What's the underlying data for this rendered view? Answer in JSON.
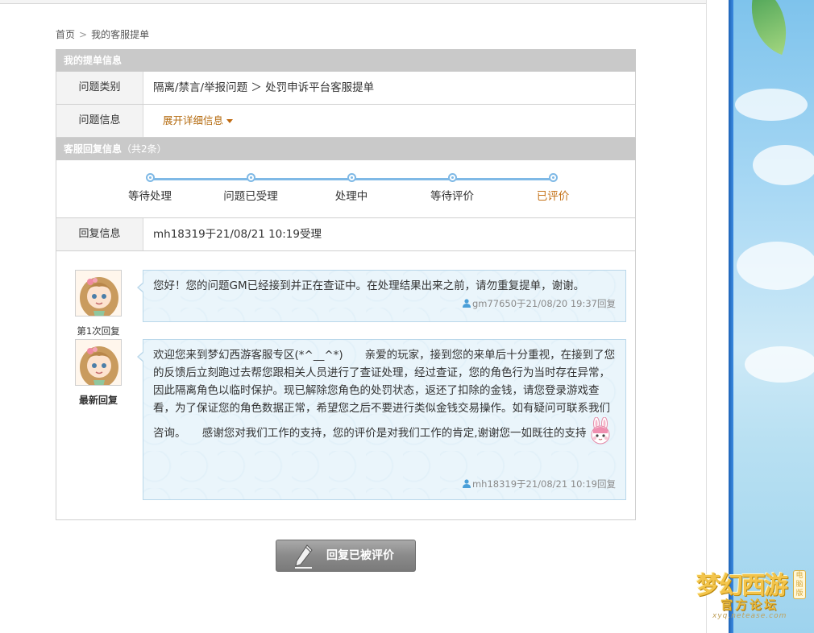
{
  "breadcrumb": {
    "home": "首页",
    "current": "我的客服提单"
  },
  "ticket_section": {
    "title": "我的提单信息",
    "category_label": "问题类别",
    "category_value": "隔离/禁言/举报问题 ＞ 处罚申诉平台客服提单",
    "info_label": "问题信息",
    "expand_link": "展开详细信息"
  },
  "reply_section": {
    "title": "客服回复信息",
    "count": "（共2条）",
    "steps": [
      {
        "label": "等待处理",
        "state": "done"
      },
      {
        "label": "问题已受理",
        "state": "done"
      },
      {
        "label": "处理中",
        "state": "done"
      },
      {
        "label": "等待评价",
        "state": "done"
      },
      {
        "label": "已评价",
        "state": "current"
      }
    ],
    "reply_info_label": "回复信息",
    "reply_info_value": "mh18319于21/08/21 10:19受理"
  },
  "replies": [
    {
      "tag": "第1次回复",
      "text": "您好！您的问题GM已经接到并正在查证中。在处理结果出来之前，请勿重复提单，谢谢。",
      "meta": "gm77650于21/08/20 19:37回复"
    },
    {
      "tag": "最新回复",
      "text": "欢迎您来到梦幻西游客服专区(*^__^*)　　亲爱的玩家，接到您的来单后十分重视，在接到了您的反馈后立刻跑过去帮您跟相关人员进行了查证处理，经过查证，您的角色行为当时存在异常，因此隔离角色以临时保护。现已解除您角色的处罚状态，返还了扣除的金钱，请您登录游戏查看，为了保证您的角色数据正常，希望您之后不要进行类似金钱交易操作。如有疑问可联系我们咨询。　　感谢您对我们工作的支持，您的评价是对我们工作的肯定,谢谢您一如既往的支持",
      "meta": "mh18319于21/08/21 10:19回复"
    }
  ],
  "actions": {
    "rated_button": "回复已被评价"
  },
  "logo": {
    "main": "梦幻西游",
    "sub": "官方论坛",
    "url": "xyq.netease.com",
    "tag": "电脑版"
  },
  "colors": {
    "accent_orange": "#c5731a",
    "progress_blue": "#7fb9e6",
    "header_gray": "#c9c9c9",
    "bubble_bg": "#eaf5fb"
  }
}
